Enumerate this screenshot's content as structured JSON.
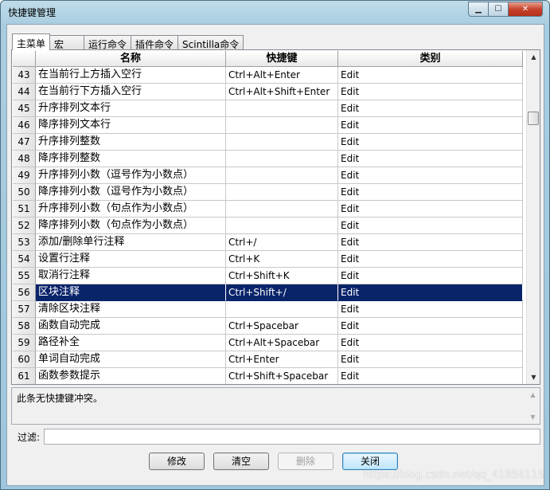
{
  "window": {
    "title": "快捷键管理",
    "controls": {
      "minimize_glyph": "▁",
      "maximize_glyph": "☐",
      "close_glyph": "✕"
    }
  },
  "tabs": [
    {
      "label": "主菜单",
      "active": true
    },
    {
      "label": "宏",
      "active": false
    },
    {
      "label": "运行命令",
      "active": false
    },
    {
      "label": "插件命令",
      "active": false
    },
    {
      "label": "Scintilla命令",
      "active": false
    }
  ],
  "table": {
    "columns": [
      "名称",
      "快捷键",
      "类别"
    ],
    "rows": [
      {
        "num": "43",
        "name": "在当前行上方插入空行",
        "shortcut": "Ctrl+Alt+Enter",
        "category": "Edit"
      },
      {
        "num": "44",
        "name": "在当前行下方插入空行",
        "shortcut": "Ctrl+Alt+Shift+Enter",
        "category": "Edit"
      },
      {
        "num": "45",
        "name": "升序排列文本行",
        "shortcut": "",
        "category": "Edit"
      },
      {
        "num": "46",
        "name": "降序排列文本行",
        "shortcut": "",
        "category": "Edit"
      },
      {
        "num": "47",
        "name": "升序排列整数",
        "shortcut": "",
        "category": "Edit"
      },
      {
        "num": "48",
        "name": "降序排列整数",
        "shortcut": "",
        "category": "Edit"
      },
      {
        "num": "49",
        "name": "升序排列小数（逗号作为小数点）",
        "shortcut": "",
        "category": "Edit"
      },
      {
        "num": "50",
        "name": "降序排列小数（逗号作为小数点）",
        "shortcut": "",
        "category": "Edit"
      },
      {
        "num": "51",
        "name": "升序排列小数（句点作为小数点）",
        "shortcut": "",
        "category": "Edit"
      },
      {
        "num": "52",
        "name": "降序排列小数（句点作为小数点）",
        "shortcut": "",
        "category": "Edit"
      },
      {
        "num": "53",
        "name": "添加/删除单行注释",
        "shortcut": "Ctrl+/",
        "category": "Edit"
      },
      {
        "num": "54",
        "name": "设置行注释",
        "shortcut": "Ctrl+K",
        "category": "Edit"
      },
      {
        "num": "55",
        "name": "取消行注释",
        "shortcut": "Ctrl+Shift+K",
        "category": "Edit"
      },
      {
        "num": "56",
        "name": "区块注释",
        "shortcut": "Ctrl+Shift+/",
        "category": "Edit",
        "selected": true
      },
      {
        "num": "57",
        "name": "清除区块注释",
        "shortcut": "",
        "category": "Edit"
      },
      {
        "num": "58",
        "name": "函数自动完成",
        "shortcut": "Ctrl+Spacebar",
        "category": "Edit"
      },
      {
        "num": "59",
        "name": "路径补全",
        "shortcut": "Ctrl+Alt+Spacebar",
        "category": "Edit"
      },
      {
        "num": "60",
        "name": "单词自动完成",
        "shortcut": "Ctrl+Enter",
        "category": "Edit"
      },
      {
        "num": "61",
        "name": "函数参数提示",
        "shortcut": "Ctrl+Shift+Spacebar",
        "category": "Edit"
      }
    ]
  },
  "conflict_message": "此条无快捷键冲突。",
  "filter": {
    "label": "过滤:",
    "value": ""
  },
  "buttons": {
    "modify": "修改",
    "clear": "清空",
    "delete": "删除",
    "close": "关闭"
  },
  "watermark": "https://blog.csdn.net/qq_41856115",
  "colors": {
    "selection": "#0a246a",
    "title_bar": "#a9cde0"
  }
}
